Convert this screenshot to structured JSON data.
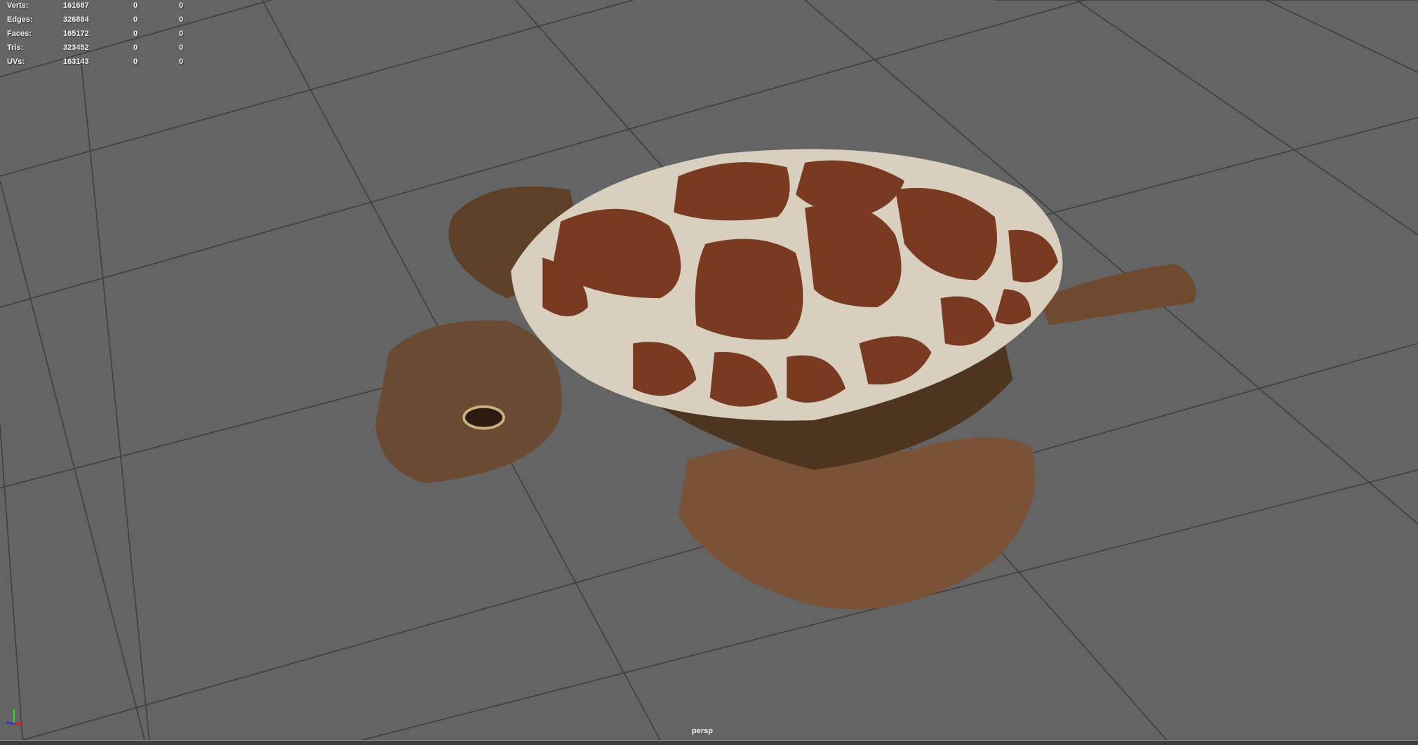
{
  "hud": {
    "rows": [
      {
        "label": "Verts:",
        "value": "161687",
        "sel1": "0",
        "sel2": "0"
      },
      {
        "label": "Edges:",
        "value": "326884",
        "sel1": "0",
        "sel2": "0"
      },
      {
        "label": "Faces:",
        "value": "165172",
        "sel1": "0",
        "sel2": "0"
      },
      {
        "label": "Tris:",
        "value": "323452",
        "sel1": "0",
        "sel2": "0"
      },
      {
        "label": "UVs:",
        "value": "163143",
        "sel1": "0",
        "sel2": "0"
      }
    ]
  },
  "viewport": {
    "camera": "persp",
    "background": "#646464",
    "grid_color": "#3e3e3e"
  },
  "axis_gizmo": {
    "icon": "axis-gizmo-icon",
    "y_color": "#3ccf3c",
    "x_color": "#d02020",
    "z_color": "#2a3ad0"
  }
}
